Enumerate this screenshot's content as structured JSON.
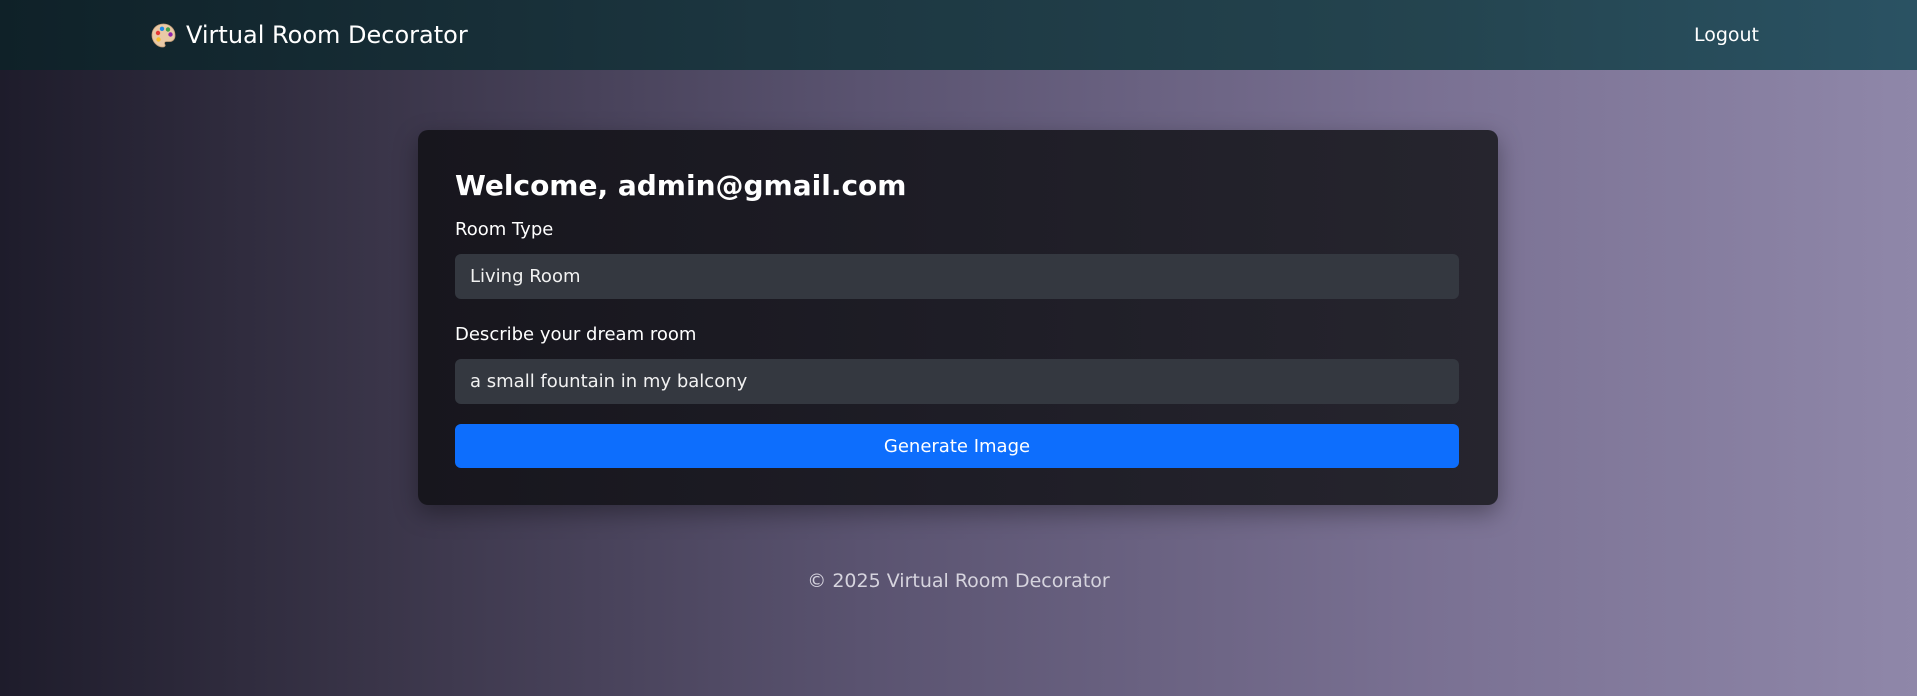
{
  "navbar": {
    "brand_icon": "palette-icon",
    "brand_label": "Virtual Room Decorator",
    "logout_label": "Logout"
  },
  "card": {
    "welcome_text": "Welcome, admin@gmail.com",
    "room_type_label": "Room Type",
    "room_type_value": "Living Room",
    "describe_label": "Describe your dream room",
    "describe_value": "a small fountain in my balcony",
    "generate_label": "Generate Image"
  },
  "footer": {
    "text": "© 2025 Virtual Room Decorator"
  },
  "colors": {
    "accent": "#0d6efd",
    "field_bg": "#343840",
    "card_bg": "#1e1d26"
  }
}
